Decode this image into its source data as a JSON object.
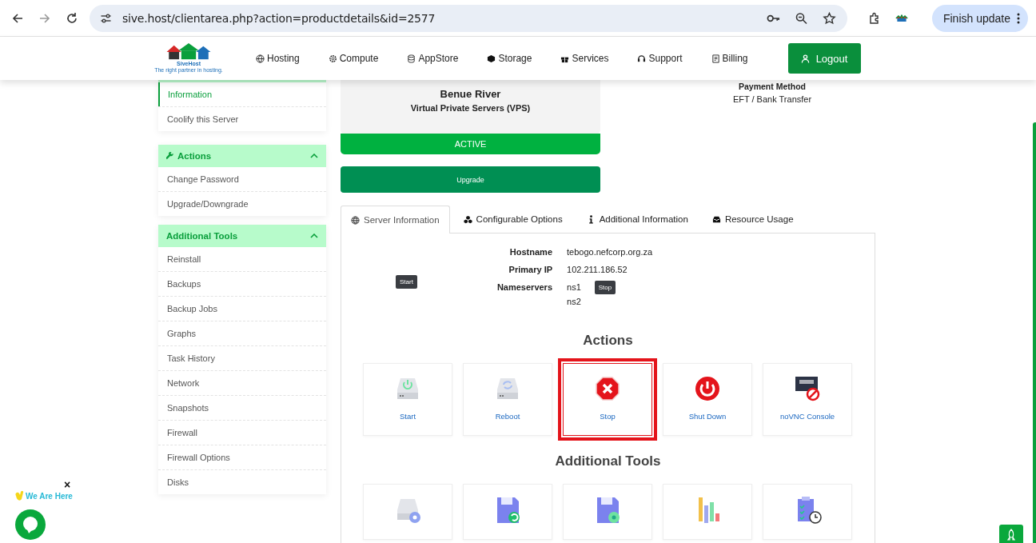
{
  "browser": {
    "url": "sive.host/clientarea.php?action=productdetails&id=2577",
    "update_button": "Finish update"
  },
  "site_nav": {
    "logo_name": "SiveHost",
    "logo_tagline": "The right partner in hosting.",
    "items": [
      {
        "label": "Hosting"
      },
      {
        "label": "Compute"
      },
      {
        "label": "AppStore"
      },
      {
        "label": "Storage"
      },
      {
        "label": "Services"
      },
      {
        "label": "Support"
      },
      {
        "label": "Billing"
      }
    ],
    "logout": "Logout"
  },
  "sidebar": {
    "panels": [
      {
        "items": [
          {
            "label": "Information",
            "selected": true
          },
          {
            "label": "Coolify this Server",
            "selected": false
          }
        ]
      },
      {
        "title": "Actions",
        "expanded": true,
        "items": [
          {
            "label": "Change Password",
            "selected": false
          },
          {
            "label": "Upgrade/Downgrade",
            "selected": false
          }
        ]
      },
      {
        "title": "Additional Tools",
        "expanded": true,
        "items": [
          {
            "label": "Reinstall",
            "selected": false
          },
          {
            "label": "Backups",
            "selected": false
          },
          {
            "label": "Backup Jobs",
            "selected": false
          },
          {
            "label": "Graphs",
            "selected": false
          },
          {
            "label": "Task History",
            "selected": false
          },
          {
            "label": "Network",
            "selected": false
          },
          {
            "label": "Snapshots",
            "selected": false
          },
          {
            "label": "Firewall",
            "selected": false
          },
          {
            "label": "Firewall Options",
            "selected": false
          },
          {
            "label": "Disks",
            "selected": false
          }
        ]
      }
    ]
  },
  "product": {
    "name": "Benue River",
    "group": "Virtual Private Servers (VPS)",
    "status": "ACTIVE",
    "upgrade": "Upgrade"
  },
  "payment": {
    "label": "Payment Method",
    "value": "EFT / Bank Transfer"
  },
  "tabs": [
    {
      "label": "Server Information",
      "selected": true
    },
    {
      "label": "Configurable Options",
      "selected": false
    },
    {
      "label": "Additional Information",
      "selected": false
    },
    {
      "label": "Resource Usage",
      "selected": false
    }
  ],
  "server_info": [
    {
      "label": "Hostname",
      "values": [
        "tebogo.nefcorp.org.za"
      ]
    },
    {
      "label": "Primary IP",
      "values": [
        "102.211.186.52"
      ]
    },
    {
      "label": "Nameservers",
      "values": [
        "ns1",
        "ns2"
      ]
    }
  ],
  "tooltips": [
    "Start",
    "Stop"
  ],
  "actions": {
    "title": "Actions",
    "items": [
      {
        "label": "Start",
        "highlighted": false
      },
      {
        "label": "Reboot",
        "highlighted": false
      },
      {
        "label": "Stop",
        "highlighted": true
      },
      {
        "label": "Shut Down",
        "highlighted": false
      },
      {
        "label": "noVNC Console",
        "highlighted": false
      }
    ]
  },
  "additional_tools": {
    "title": "Additional Tools"
  },
  "chat_widget": {
    "caption": "We Are Here",
    "close": "×"
  }
}
